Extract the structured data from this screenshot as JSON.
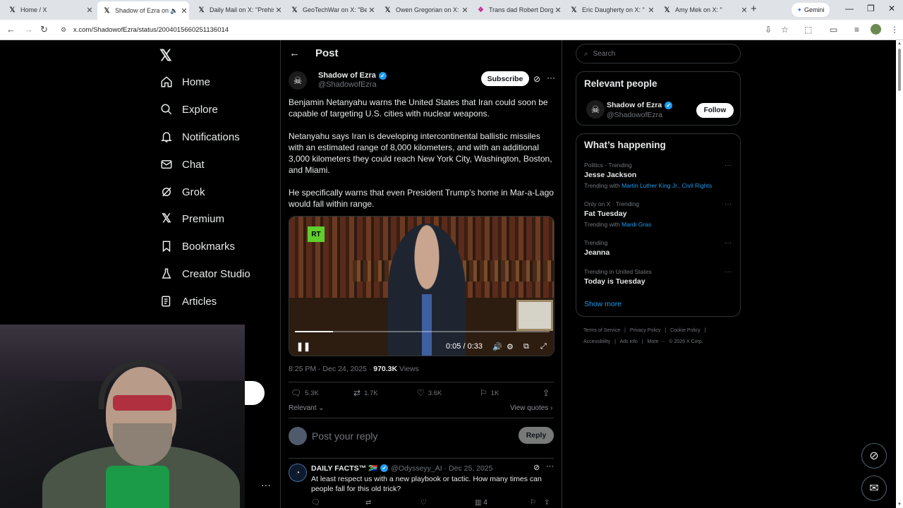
{
  "browser": {
    "tabs": [
      {
        "title": "Home / X",
        "favicon": "x-logo"
      },
      {
        "title": "Shadow of Ezra on X",
        "favicon": "x-logo",
        "active": true
      },
      {
        "title": "Daily Mail on X: \"Prehist",
        "favicon": "x-logo"
      },
      {
        "title": "GeoTechWar on X: \"Bee",
        "favicon": "x-logo"
      },
      {
        "title": "Owen Gregorian on X: \"",
        "favicon": "x-logo"
      },
      {
        "title": "Trans dad Robert Dorgan",
        "favicon": "rainbow-logo"
      },
      {
        "title": "Eric Daugherty on X: \"",
        "favicon": "x-logo"
      },
      {
        "title": "Amy Mek on X: \"",
        "favicon": "x-logo"
      }
    ],
    "gemini_label": "Gemini",
    "url": "x.com/ShadowofEzra/status/2004015660251136014"
  },
  "nav": {
    "items": [
      {
        "label": "Home",
        "icon": "home-icon"
      },
      {
        "label": "Explore",
        "icon": "search-icon"
      },
      {
        "label": "Notifications",
        "icon": "bell-icon"
      },
      {
        "label": "Chat",
        "icon": "mail-icon"
      },
      {
        "label": "Grok",
        "icon": "grok-icon"
      },
      {
        "label": "Premium",
        "icon": "x-icon"
      },
      {
        "label": "Bookmarks",
        "icon": "bookmark-icon"
      },
      {
        "label": "Creator Studio",
        "icon": "flask-icon"
      },
      {
        "label": "Articles",
        "icon": "article-icon"
      }
    ]
  },
  "post": {
    "header_title": "Post",
    "author_name": "Shadow of Ezra",
    "author_handle": "@ShadowofEzra",
    "subscribe_label": "Subscribe",
    "paragraphs": [
      "Benjamin Netanyahu warns the United States that Iran could soon be capable of targeting U.S. cities with nuclear weapons.",
      "Netanyahu says Iran is developing intercontinental ballistic missiles with an estimated range of 8,000 kilometers, and with an additional 3,000 kilometers they could reach New York City, Washington, Boston, and Miami.",
      "He specifically warns that even President Trump’s home in Mar-a-Lago would fall within range."
    ],
    "video": {
      "time": "0:05 / 0:33",
      "progress": 0.15,
      "logo_text": "RT"
    },
    "timestamp": "8:25 PM · Dec 24, 2025 · ",
    "views_count": "970.3K",
    "views_label": " Views",
    "stats": {
      "replies": "5.3K",
      "reposts": "1.7K",
      "likes": "3.6K",
      "bookmarks": "1K"
    },
    "sort_label": "Relevant",
    "view_quotes_label": "View quotes",
    "reply_placeholder": "Post your reply",
    "reply_button": "Reply"
  },
  "reply": {
    "name": "DAILY FACTS™ 🇿🇦",
    "meta": "@Odysseyy_AI · Dec 25, 2025",
    "text": "At least respect us with a new playbook or tactic. How many times can people fall for this old trick?",
    "views": "4"
  },
  "right": {
    "search_placeholder": "Search",
    "relevant_title": "Relevant people",
    "person_name": "Shadow of Ezra",
    "person_handle": "@ShadowofEzra",
    "follow_label": "Follow",
    "happening_title": "What’s happening",
    "trends": [
      {
        "context": "Politics · Trending",
        "title": "Jesse Jackson",
        "with_prefix": "Trending with ",
        "with": "Martin Luther King Jr., Civil Rights"
      },
      {
        "context": "Only on X · Trending",
        "title": "Fat Tuesday",
        "with_prefix": "Trending with ",
        "with": "Mardi Gras"
      },
      {
        "context": "Trending",
        "title": "Jeanna",
        "with_prefix": "",
        "with": ""
      },
      {
        "context": "Trending in United States",
        "title": "Today is Tuesday",
        "with_prefix": "",
        "with": ""
      }
    ],
    "show_more": "Show more",
    "footer": [
      "Terms of Service",
      "|",
      "Privacy Policy",
      "|",
      "Cookie Policy",
      "|",
      "Accessibility",
      "|",
      "Ads info",
      "|",
      "More ···",
      "© 2026 X Corp."
    ]
  }
}
